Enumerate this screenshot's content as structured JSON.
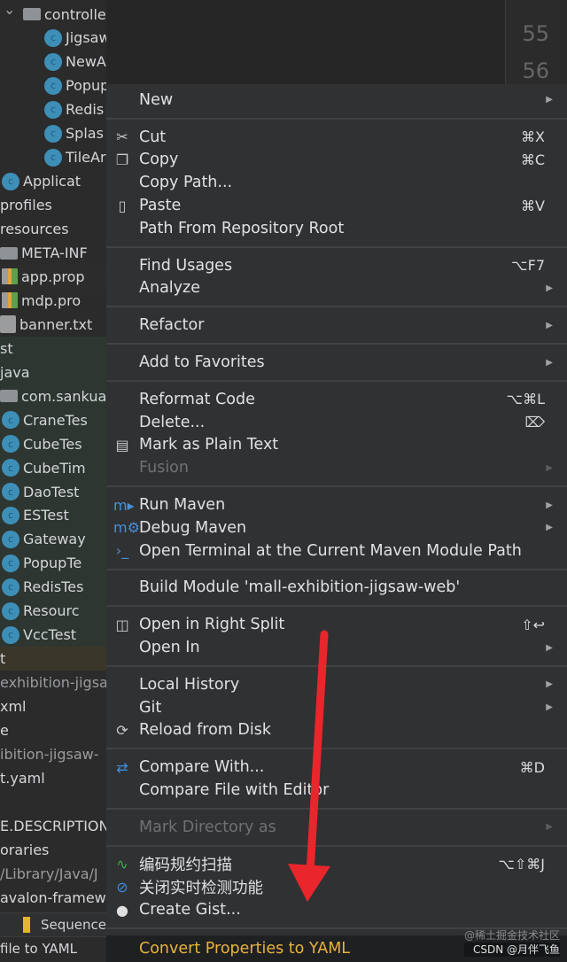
{
  "editor": {
    "line_numbers": [
      "55",
      "56"
    ]
  },
  "tree": [
    {
      "label": "controller",
      "icon": "folder-icon",
      "chev": true
    },
    {
      "label": "JigsawCubeInitController",
      "icon": "class-icon"
    },
    {
      "label": "NewAreaInitController",
      "icon": "class-icon"
    },
    {
      "label": "PopupController",
      "icon": "class-icon"
    },
    {
      "label": "Redis",
      "icon": "class-icon"
    },
    {
      "label": "Splas",
      "icon": "class-icon"
    },
    {
      "label": "TileAr",
      "icon": "class-icon"
    },
    {
      "label": "Applicat",
      "icon": "spring-boot-class-icon"
    },
    {
      "label": "profiles"
    },
    {
      "label": "resources"
    },
    {
      "label": "META-INF",
      "icon": "folder-icon"
    },
    {
      "label": "app.prop",
      "icon": "properties-file-icon"
    },
    {
      "label": "mdp.pro",
      "icon": "properties-file-icon"
    },
    {
      "label": "banner.txt",
      "icon": "text-file-icon"
    },
    {
      "label": "st"
    },
    {
      "label": "java"
    },
    {
      "label": "com.sankua",
      "icon": "folder-icon"
    },
    {
      "label": "CraneTes",
      "icon": "test-class-icon"
    },
    {
      "label": "CubeTes",
      "icon": "test-class-icon"
    },
    {
      "label": "CubeTim",
      "icon": "test-class-icon"
    },
    {
      "label": "DaoTest",
      "icon": "test-class-icon"
    },
    {
      "label": "ESTest",
      "icon": "test-class-icon"
    },
    {
      "label": "Gateway",
      "icon": "test-class-icon"
    },
    {
      "label": "PopupTe",
      "icon": "test-class-icon"
    },
    {
      "label": "RedisTes",
      "icon": "test-class-icon"
    },
    {
      "label": "Resourc",
      "icon": "test-class-icon"
    },
    {
      "label": "VccTest",
      "icon": "test-class-icon"
    },
    {
      "label": "t"
    },
    {
      "label": "exhibition-jigsa"
    },
    {
      "label": "xml"
    },
    {
      "label": "e"
    },
    {
      "label": "ibition-jigsaw-"
    },
    {
      "label": "t.yaml"
    },
    {
      "label": ""
    },
    {
      "label": "E.DESCRIPTION"
    },
    {
      "label": "oraries"
    },
    {
      "label": "/Library/Java/J"
    },
    {
      "label": "avalon-framew"
    }
  ],
  "bottom": {
    "tool_tab": "Sequence",
    "status": "file to YAML"
  },
  "menu": [
    {
      "label": "New",
      "submenu": true
    },
    {
      "sep": true
    },
    {
      "label": "Cut",
      "icon": "scissors-icon",
      "shortcut": "⌘X"
    },
    {
      "label": "Copy",
      "icon": "copy-icon",
      "shortcut": "⌘C"
    },
    {
      "label": "Copy Path..."
    },
    {
      "label": "Paste",
      "icon": "clipboard-icon",
      "shortcut": "⌘V"
    },
    {
      "label": "Path From Repository Root"
    },
    {
      "sep": true
    },
    {
      "label": "Find Usages",
      "shortcut": "⌥F7"
    },
    {
      "label": "Analyze",
      "submenu": true
    },
    {
      "sep": true
    },
    {
      "label": "Refactor",
      "submenu": true
    },
    {
      "sep": true
    },
    {
      "label": "Add to Favorites",
      "submenu": true
    },
    {
      "sep": true
    },
    {
      "label": "Reformat Code",
      "shortcut": "⌥⌘L"
    },
    {
      "label": "Delete...",
      "shortcut": "⌦"
    },
    {
      "label": "Mark as Plain Text",
      "icon": "plain-text-icon"
    },
    {
      "label": "Fusion",
      "submenu": true,
      "disabled": true
    },
    {
      "sep": true
    },
    {
      "label": "Run Maven",
      "icon": "maven-run-icon",
      "submenu": true
    },
    {
      "label": "Debug Maven",
      "icon": "maven-debug-icon",
      "submenu": true
    },
    {
      "label": "Open Terminal at the Current Maven Module Path",
      "icon": "maven-terminal-icon"
    },
    {
      "sep": true
    },
    {
      "label": "Build Module 'mall-exhibition-jigsaw-web'"
    },
    {
      "sep": true
    },
    {
      "label": "Open in Right Split",
      "icon": "split-icon",
      "shortcut": "⇧↩"
    },
    {
      "label": "Open In",
      "submenu": true
    },
    {
      "sep": true
    },
    {
      "label": "Local History",
      "submenu": true
    },
    {
      "label": "Git",
      "submenu": true
    },
    {
      "label": "Reload from Disk",
      "icon": "reload-icon"
    },
    {
      "sep": true
    },
    {
      "label": "Compare With...",
      "icon": "compare-icon",
      "shortcut": "⌘D"
    },
    {
      "label": "Compare File with Editor"
    },
    {
      "sep": true
    },
    {
      "label": "Mark Directory as",
      "submenu": true,
      "disabled": true
    },
    {
      "sep": true
    },
    {
      "label": "编码规约扫描",
      "icon": "code-scan-icon",
      "shortcut": "⌥⇧⌘J"
    },
    {
      "label": "关闭实时检测功能",
      "icon": "disable-icon"
    },
    {
      "label": "Create Gist...",
      "icon": "github-icon"
    },
    {
      "sep": true
    },
    {
      "label": "Convert Properties to YAML",
      "highlighted": true
    }
  ],
  "watermark": {
    "line1": "@稀土掘金技术社区",
    "line2": "CSDN @月伴飞鱼"
  },
  "colors": {
    "menu_bg": "#303133",
    "highlight_text": "#e8b33a",
    "arrow": "#e8262b"
  }
}
